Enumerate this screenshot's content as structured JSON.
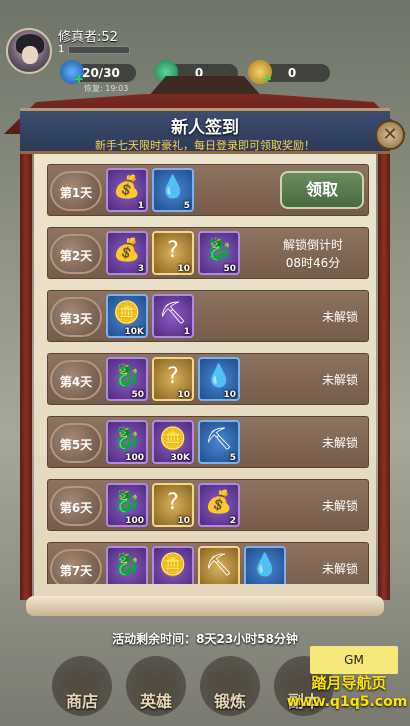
{
  "player": {
    "name": "修真者:52",
    "level": "1"
  },
  "resources": {
    "stamina": "20/30",
    "recover": "恢复: 19:03",
    "jade": "0",
    "coin": "0"
  },
  "dialog": {
    "title": "新人签到",
    "subtitle": "新手七天限时豪礼，每日登录即可领取奖励！",
    "close_icon": "close-icon"
  },
  "days": [
    {
      "label": "第1天",
      "status": "领取",
      "items": [
        {
          "icon": "money-bag",
          "q": "1",
          "color": "purple"
        },
        {
          "icon": "stamina-drop",
          "q": "5",
          "color": "blue"
        }
      ]
    },
    {
      "label": "第2天",
      "status": "解锁倒计时\n08时46分",
      "items": [
        {
          "icon": "money-bag",
          "q": "3",
          "color": "purple"
        },
        {
          "icon": "mystery-scroll",
          "q": "10",
          "color": "gold"
        },
        {
          "icon": "jade-dragon",
          "q": "50",
          "color": "purple"
        }
      ]
    },
    {
      "label": "第3天",
      "status": "未解锁",
      "items": [
        {
          "icon": "gold-coin",
          "q": "10K",
          "color": "blue"
        },
        {
          "icon": "shovel",
          "q": "1",
          "color": "purple"
        }
      ]
    },
    {
      "label": "第4天",
      "status": "未解锁",
      "items": [
        {
          "icon": "jade-dragon",
          "q": "50",
          "color": "purple"
        },
        {
          "icon": "mystery-scroll",
          "q": "10",
          "color": "gold"
        },
        {
          "icon": "stamina-drop",
          "q": "10",
          "color": "blue"
        }
      ]
    },
    {
      "label": "第5天",
      "status": "未解锁",
      "items": [
        {
          "icon": "jade-dragon",
          "q": "100",
          "color": "purple"
        },
        {
          "icon": "gold-coin",
          "q": "30K",
          "color": "purple"
        },
        {
          "icon": "shovel",
          "q": "5",
          "color": "blue"
        }
      ]
    },
    {
      "label": "第6天",
      "status": "未解锁",
      "items": [
        {
          "icon": "jade-dragon",
          "q": "100",
          "color": "purple"
        },
        {
          "icon": "mystery-scroll",
          "q": "10",
          "color": "gold"
        },
        {
          "icon": "money-bag",
          "q": "2",
          "color": "purple"
        }
      ]
    },
    {
      "label": "第7天",
      "status": "未解锁",
      "items": [
        {
          "icon": "jade-dragon",
          "q": "",
          "color": "purple"
        },
        {
          "icon": "gold-coin",
          "q": "",
          "color": "purple"
        },
        {
          "icon": "shovel",
          "q": "",
          "color": "gold"
        },
        {
          "icon": "stamina-drop",
          "q": "",
          "color": "blue"
        }
      ]
    }
  ],
  "footer": {
    "remaining": "活动剩余时间：8天23小时58分钟",
    "nav": [
      "商店",
      "英雄",
      "锻炼",
      "副本"
    ],
    "gm": "GM",
    "watermark1": "踏月导航页",
    "watermark2": "www.q1q5.com"
  }
}
